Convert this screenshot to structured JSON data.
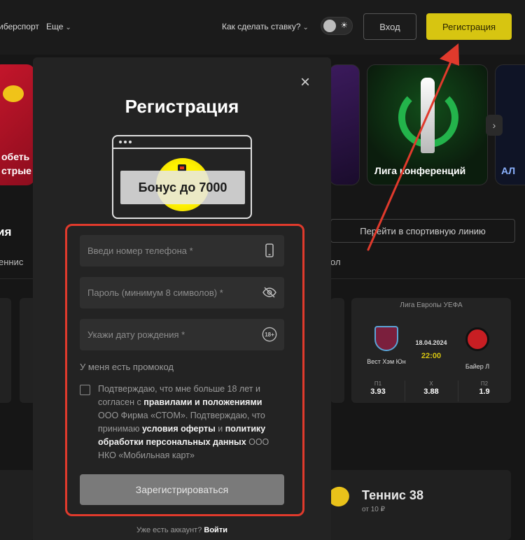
{
  "header": {
    "nav_esports": "иберспорт",
    "nav_more": "Еще",
    "nav_howto": "Как сделать ставку?",
    "login_label": "Вход",
    "register_label": "Регистрация"
  },
  "background": {
    "promo_red_text": "обеть\nстрые",
    "promo_conference": "Лига конференций",
    "promo_right_text": "АЛ",
    "left_heading": "ия",
    "left_tab": "еннис",
    "sport_line_button": "Перейти в спортивную линию",
    "right_tab": "ол",
    "match": {
      "league": "Лига Европы УЕФА",
      "home": "Вест Хэм Юн",
      "away": "Байер Л",
      "date": "18.04.2024",
      "time": "22:00",
      "odds": [
        {
          "label": "П1",
          "value": "3.93"
        },
        {
          "label": "Х",
          "value": "3.88"
        },
        {
          "label": "П2",
          "value": "1.9"
        }
      ]
    },
    "tennis": {
      "title": "Теннис 38",
      "price": "от 10 ₽"
    }
  },
  "modal": {
    "close_symbol": "×",
    "title": "Регистрация",
    "bonus_text": "Бонус до 7000",
    "phone_placeholder": "Введи номер телефона *",
    "password_placeholder": "Пароль (минимум 8 символов) *",
    "birthdate_placeholder": "Укажи дату рождения *",
    "age_badge": "18+",
    "promo_code_link": "У меня есть промокод",
    "consent": {
      "part1": "Подтверждаю, что мне больше 18 лет и согласен с ",
      "link1": "правилами и положениями",
      "part2": " ООО Фирма «СТОМ». Подтверждаю, что принимаю ",
      "link2": "условия оферты",
      "part3": " и ",
      "link3": "политику обработки персональных данных",
      "part4": " ООО НКО «Мобильная карт»"
    },
    "submit_label": "Зарегистрироваться",
    "footer_question": "Уже есть аккаунт?",
    "footer_login": "Войти"
  },
  "colors": {
    "accent_yellow": "#d7c511",
    "annotation_red": "#e03a2c"
  }
}
